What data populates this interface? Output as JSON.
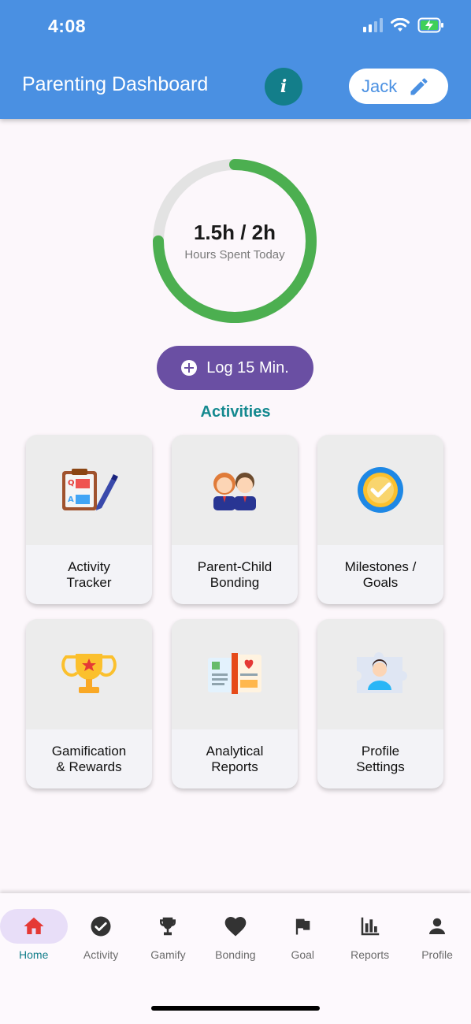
{
  "status_bar": {
    "time": "4:08"
  },
  "header": {
    "title": "Parenting Dashboard",
    "info_symbol": "i",
    "user_name": "Jack"
  },
  "progress": {
    "value_text": "1.5h / 2h",
    "caption": "Hours Spent Today",
    "fraction": 0.75,
    "color": "#4caf50"
  },
  "log_button": {
    "label": "Log 15 Min."
  },
  "activities": {
    "title": "Activities",
    "cards": [
      {
        "label": "Activity\nTracker",
        "icon": "clipboard-icon"
      },
      {
        "label": "Parent-Child\nBonding",
        "icon": "kids-icon"
      },
      {
        "label": "Milestones /\nGoals",
        "icon": "badge-check-icon"
      },
      {
        "label": "Gamification\n& Rewards",
        "icon": "trophy-icon"
      },
      {
        "label": "Analytical\nReports",
        "icon": "report-book-icon"
      },
      {
        "label": "Profile\nSettings",
        "icon": "profile-puzzle-icon"
      }
    ]
  },
  "bottom_nav": {
    "items": [
      {
        "label": "Home",
        "icon": "home-icon",
        "active": true
      },
      {
        "label": "Activity",
        "icon": "check-circle-icon",
        "active": false
      },
      {
        "label": "Gamify",
        "icon": "trophy-icon",
        "active": false
      },
      {
        "label": "Bonding",
        "icon": "heart-icon",
        "active": false
      },
      {
        "label": "Goal",
        "icon": "flag-icon",
        "active": false
      },
      {
        "label": "Reports",
        "icon": "bar-chart-icon",
        "active": false
      },
      {
        "label": "Profile",
        "icon": "person-icon",
        "active": false
      }
    ]
  },
  "colors": {
    "header": "#4a90e2",
    "accent": "#137e8a",
    "button": "#6a4fa3",
    "home_active": "#e53935"
  }
}
